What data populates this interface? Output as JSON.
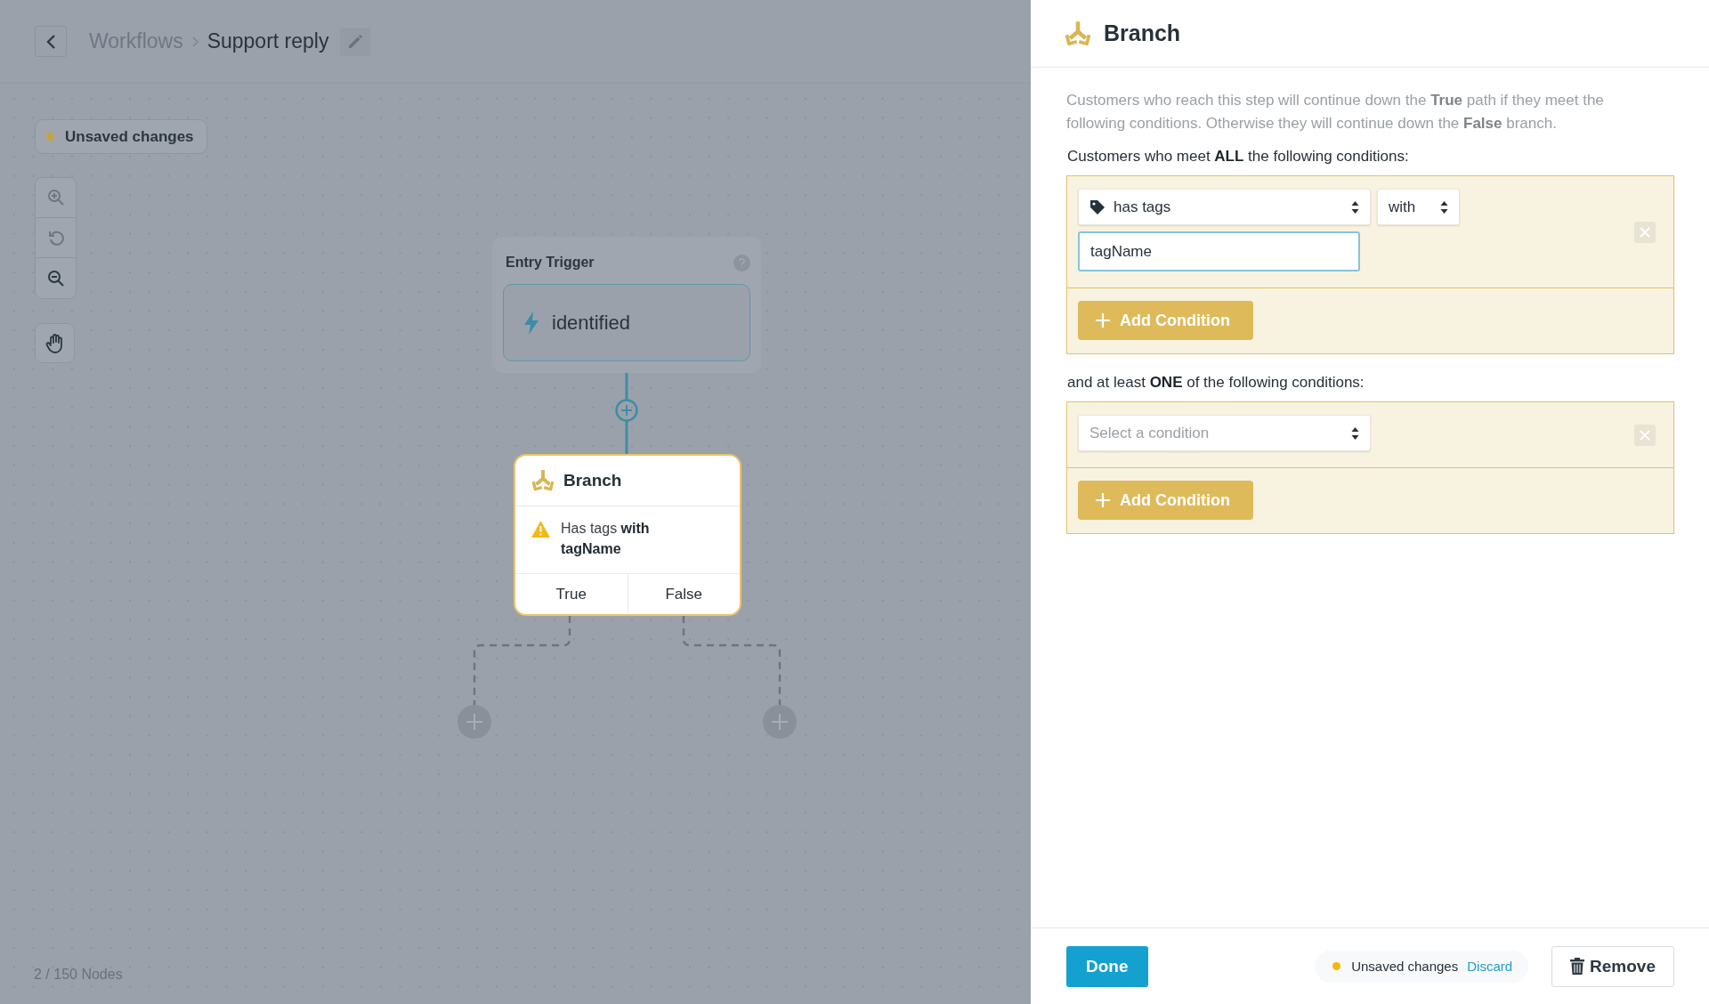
{
  "header": {
    "breadcrumb": [
      {
        "label": "Workflows",
        "current": false
      },
      {
        "label": "Support reply",
        "current": true
      }
    ]
  },
  "canvas": {
    "status": "Unsaved changes",
    "tools": [
      {
        "kind": "zoom-in",
        "disabled": true
      },
      {
        "kind": "reset",
        "disabled": true
      },
      {
        "kind": "zoom-out",
        "disabled": false
      }
    ],
    "pan_tool": {
      "selected": false
    },
    "entry_trigger": {
      "title": "Entry Trigger",
      "event": "identified"
    },
    "branch_node": {
      "title": "Branch",
      "summary": "Has tags **with tagName**",
      "warning": true,
      "outputs": [
        {
          "label": "True"
        },
        {
          "label": "False"
        }
      ]
    },
    "node_count": "2 / 150 Nodes"
  },
  "panel": {
    "title": "Branch",
    "description": "Customers who reach this step will continue down the **True** path if they meet the following conditions. Otherwise they will continue down the **False** branch.",
    "groups": [
      {
        "heading": "Customers who meet **ALL** the following conditions:",
        "conditions": [
          {
            "kind": "tag",
            "field": "has tags",
            "operator": "with",
            "value": "tagName",
            "focused": true
          }
        ],
        "add_label": "Add Condition"
      },
      {
        "heading": "and at least **ONE** of the following conditions:",
        "conditions": [
          {
            "kind": "empty",
            "placeholder": "Select a condition"
          }
        ],
        "add_label": "Add Condition"
      }
    ],
    "footer": {
      "done": "Done",
      "status": "Unsaved changes",
      "discard": "Discard",
      "remove": "Remove"
    }
  }
}
